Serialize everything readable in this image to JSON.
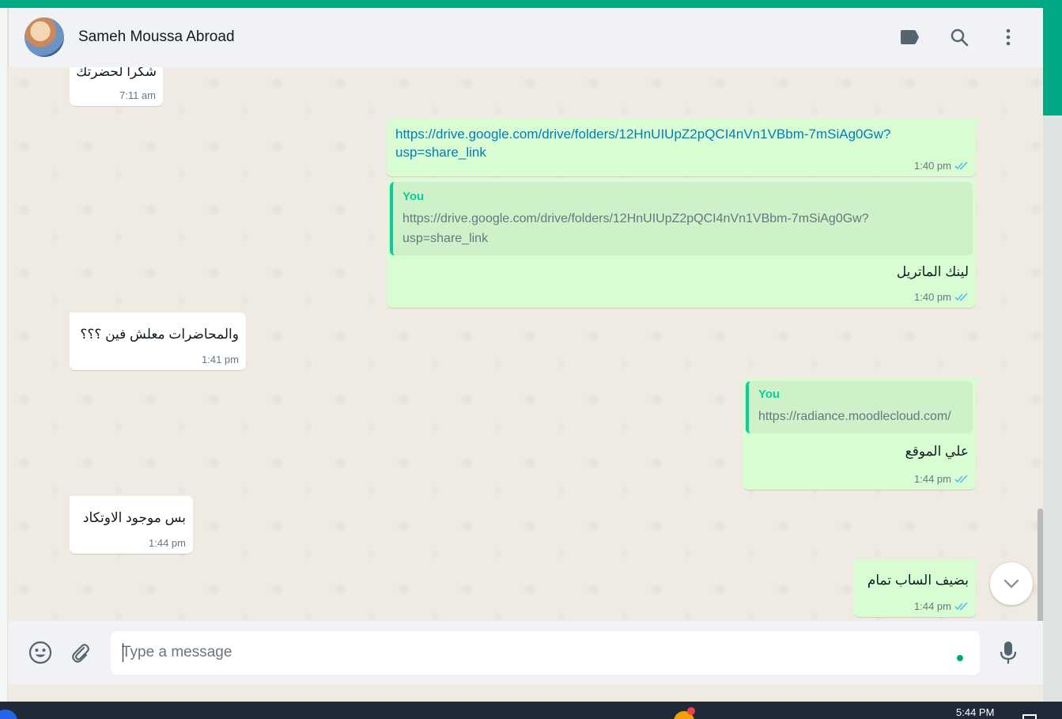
{
  "header": {
    "contact_name": "Sameh Moussa Abroad"
  },
  "messages": [
    {
      "id": "m1",
      "direction": "incoming",
      "text": "شكرا لحضرتك",
      "time": "7:11 am"
    },
    {
      "id": "m2",
      "direction": "outgoing",
      "link": "https://drive.google.com/drive/folders/12HnUIUpZ2pQCI4nVn1VBbm-7mSiAg0Gw?usp=share_link",
      "link_line1": "https://drive.google.com/drive/folders/12HnUIUpZ2pQCI4nVn1VBbm-7mSiAg0Gw?",
      "link_line2": "usp=share_link",
      "time": "1:40 pm",
      "status": "read"
    },
    {
      "id": "m3",
      "direction": "outgoing",
      "quote_author": "You",
      "quote_line1": "https://drive.google.com/drive/folders/12HnUIUpZ2pQCI4nVn1VBbm-7mSiAg0Gw?",
      "quote_line2": "usp=share_link",
      "text": "لينك الماتريل",
      "time": "1:40 pm",
      "status": "read"
    },
    {
      "id": "m4",
      "direction": "incoming",
      "text": "والمحاضرات معلش فين ؟؟؟",
      "time": "1:41 pm"
    },
    {
      "id": "m5",
      "direction": "outgoing",
      "quote_author": "You",
      "quote_line1": "https://radiance.moodlecloud.com/",
      "text": "علي الموقع",
      "time": "1:44 pm",
      "status": "read"
    },
    {
      "id": "m6",
      "direction": "incoming",
      "text": "بس موجود الاوتكاد",
      "time": "1:44 pm"
    },
    {
      "id": "m7",
      "direction": "outgoing",
      "text": "بضيف الساب تمام",
      "time": "1:44 pm",
      "status": "read"
    }
  ],
  "composer": {
    "placeholder": "Type a message"
  },
  "taskbar": {
    "time": "5:44 PM"
  },
  "colors": {
    "accent": "#00a884",
    "incoming_bubble": "#ffffff",
    "outgoing_bubble": "#d9fdd3",
    "link": "#027eb5",
    "read_tick": "#53bdeb"
  },
  "icons": [
    "label-icon",
    "search-icon",
    "menu-icon",
    "emoji-icon",
    "attach-icon",
    "mic-icon",
    "chevron-down-icon",
    "double-check-icon"
  ]
}
